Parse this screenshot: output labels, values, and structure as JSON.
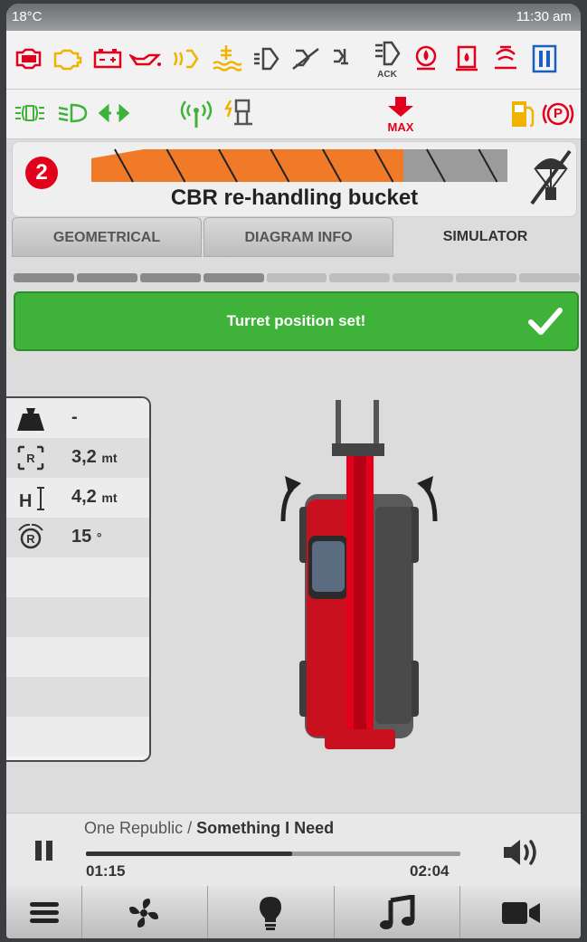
{
  "status_bar": {
    "temperature": "18°C",
    "time": "11:30 am"
  },
  "warning_icons": [
    "engine-stop-icon",
    "engine-check-icon",
    "battery-icon",
    "oil-pressure-icon",
    "glow-plug-icon",
    "coolant-level-icon",
    "transmission-oil-icon",
    "hydraulic-filter-icon",
    "hydraulic-temperature-icon",
    "transmission-ack-icon",
    "brake-fluid-icon",
    "fuel-filter-icon",
    "air-filter-icon",
    "coolant-temperature-icon"
  ],
  "warning_ack_label": "ACK",
  "info_icons": [
    "side-lights-icon",
    "low-beam-icon",
    "direction-indicators-icon",
    "wireless-signal-icon",
    "stabilizer-warning-icon",
    "max-load-icon",
    "fuel-reserve-icon",
    "parking-brake-icon"
  ],
  "max_label": "MAX",
  "parking_brake_label": "P",
  "header": {
    "step_number": "2",
    "attachment_name": "CBR re-handling bucket",
    "load_bar_filled_segments": 6,
    "load_bar_total_segments": 8
  },
  "tabs": [
    {
      "label": "GEOMETRICAL",
      "active": false
    },
    {
      "label": "DIAGRAM INFO",
      "active": false
    },
    {
      "label": "SIMULATOR",
      "active": true
    }
  ],
  "progress_segments": {
    "total": 9,
    "completed": 4
  },
  "banner": {
    "message": "Turret position set!",
    "color": "#3fb23a"
  },
  "parameters": [
    {
      "icon": "load-weight-icon",
      "value": "-",
      "unit": ""
    },
    {
      "icon": "radius-icon",
      "value": "3,2",
      "unit": "mt"
    },
    {
      "icon": "height-icon",
      "value": "4,2",
      "unit": "mt"
    },
    {
      "icon": "rotation-icon",
      "value": "15",
      "unit": "°"
    }
  ],
  "param_icon_labels": {
    "radius": "R",
    "height": "H",
    "rotation": "R"
  },
  "media_player": {
    "artist": "One Republic",
    "separator": " / ",
    "title": "Something I Need",
    "elapsed": "01:15",
    "total": "02:04",
    "progress_fraction": 0.55,
    "state": "playing"
  },
  "nav_bar": [
    "menu-icon",
    "fan-icon",
    "lightbulb-icon",
    "music-note-icon",
    "video-camera-icon"
  ],
  "colors": {
    "accent_red": "#e3001b",
    "warning_orange": "#f0b400",
    "ok_green": "#3fb23a",
    "load_orange": "#f07a28"
  }
}
